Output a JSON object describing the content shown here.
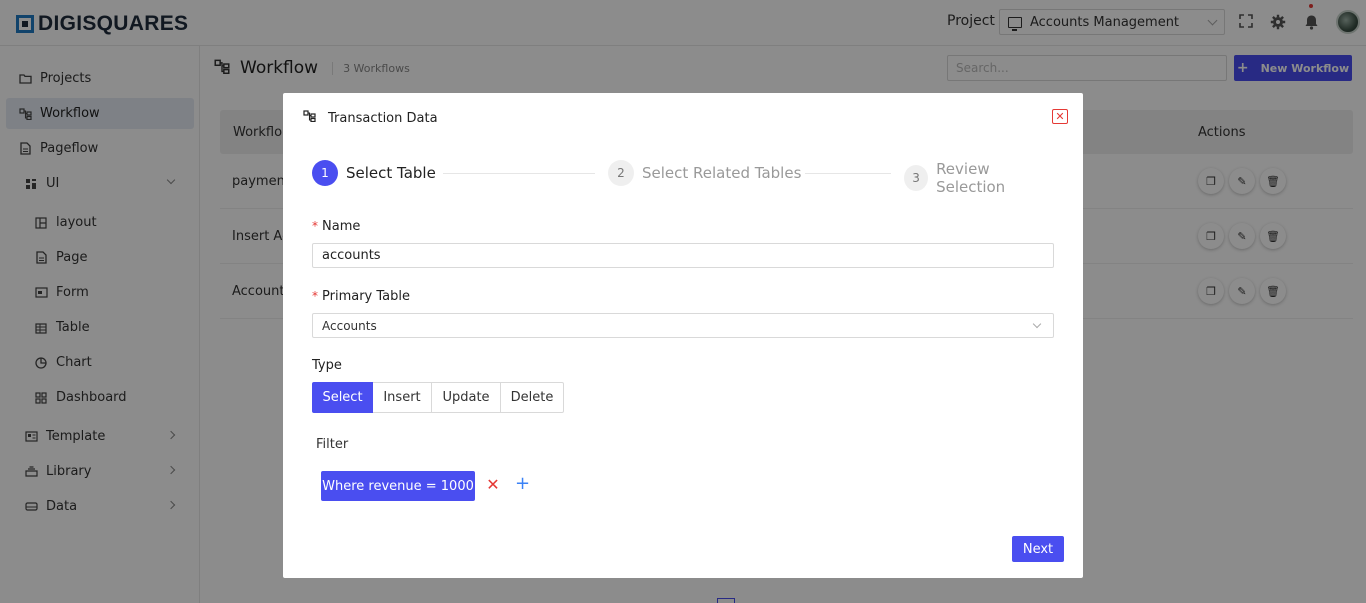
{
  "app": {
    "logo_text": "DIGISQUARES"
  },
  "header": {
    "project_label": "Project",
    "project_selected": "Accounts Management",
    "icons": [
      "fullscreen-icon",
      "gear-icon",
      "bell-icon",
      "avatar"
    ]
  },
  "sidebar": {
    "items": [
      {
        "label": "Projects",
        "icon": "folder-icon"
      },
      {
        "label": "Workflow",
        "icon": "workflow-icon",
        "active": true
      },
      {
        "label": "Pageflow",
        "icon": "file-icon"
      },
      {
        "label": "UI",
        "icon": "ui-icon",
        "expanded": true
      },
      {
        "label": "layout",
        "icon": "layout-icon"
      },
      {
        "label": "Page",
        "icon": "page-icon"
      },
      {
        "label": "Form",
        "icon": "form-icon"
      },
      {
        "label": "Table",
        "icon": "table-icon"
      },
      {
        "label": "Chart",
        "icon": "chart-icon"
      },
      {
        "label": "Dashboard",
        "icon": "dashboard-icon"
      },
      {
        "label": "Template",
        "icon": "template-icon"
      },
      {
        "label": "Library",
        "icon": "library-icon"
      },
      {
        "label": "Data",
        "icon": "data-icon"
      }
    ]
  },
  "main": {
    "title": "Workflow",
    "count": "3 Workflows",
    "search_placeholder": "Search...",
    "new_button": "New Workflow",
    "table": {
      "col_workflow": "Workflo",
      "col_actions": "Actions",
      "rows": [
        "paymen",
        "Insert Ac",
        "Account"
      ]
    }
  },
  "modal": {
    "title": "Transaction Data",
    "close": "✕",
    "steps": [
      {
        "num": "1",
        "label": "Select Table",
        "active": true
      },
      {
        "num": "2",
        "label": "Select Related Tables",
        "active": false
      },
      {
        "num": "3",
        "label": "Review Selection",
        "active": false
      }
    ],
    "name_label": "Name",
    "name_value": "accounts",
    "primary_table_label": "Primary Table",
    "primary_table_value": "Accounts",
    "type_label": "Type",
    "type_options": [
      "Select",
      "Insert",
      "Update",
      "Delete"
    ],
    "type_selected": "Select",
    "filter_label": "Filter",
    "filter_chip": "Where revenue = 1000",
    "filter_remove": "✕",
    "filter_add": "+",
    "next_button": "Next"
  },
  "colors": {
    "accent": "#4a4ef0",
    "danger": "#e53935",
    "add": "#3b82f6"
  }
}
